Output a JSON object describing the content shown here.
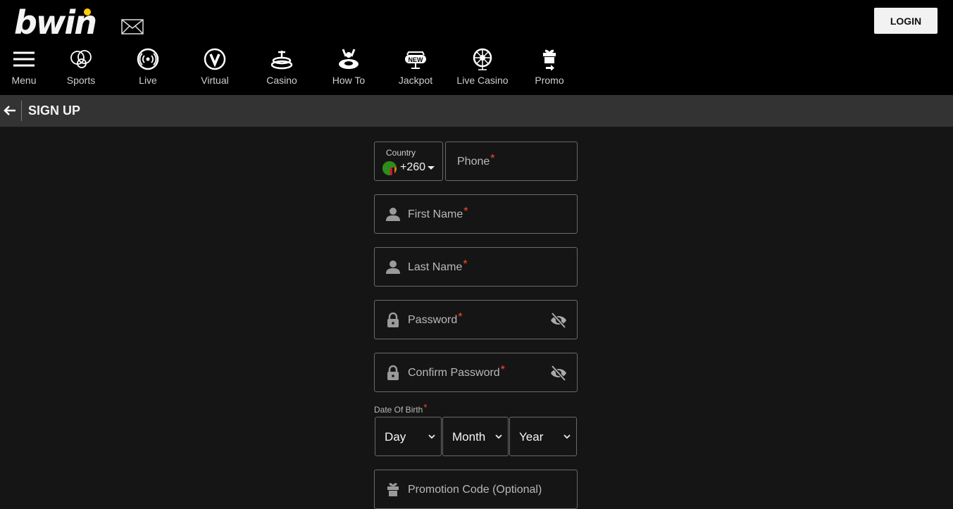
{
  "header": {
    "logo": "bwin",
    "login_label": "LOGIN",
    "nav": [
      {
        "label": "Menu",
        "icon": "menu-icon"
      },
      {
        "label": "Sports",
        "icon": "sports-icon"
      },
      {
        "label": "Live",
        "icon": "live-icon"
      },
      {
        "label": "Virtual",
        "icon": "virtual-icon"
      },
      {
        "label": "Casino",
        "icon": "casino-icon"
      },
      {
        "label": "How To",
        "icon": "how-to-icon"
      },
      {
        "label": "Jackpot",
        "icon": "jackpot-icon"
      },
      {
        "label": "Live Casino",
        "icon": "live-casino-icon"
      },
      {
        "label": "Promo",
        "icon": "promo-icon"
      }
    ]
  },
  "subbar": {
    "title": "SIGN UP"
  },
  "form": {
    "country_label": "Country",
    "country_code": "+260",
    "phone_label": "Phone",
    "first_name_label": "First Name",
    "last_name_label": "Last Name",
    "password_label": "Password",
    "confirm_password_label": "Confirm Password",
    "dob_label": "Date Of Birth",
    "day": "Day",
    "month": "Month",
    "year": "Year",
    "promo_label": "Promotion Code (Optional)",
    "required_mark": "*"
  },
  "colors": {
    "accent": "#ffcc00",
    "required": "#ff4b1f"
  }
}
